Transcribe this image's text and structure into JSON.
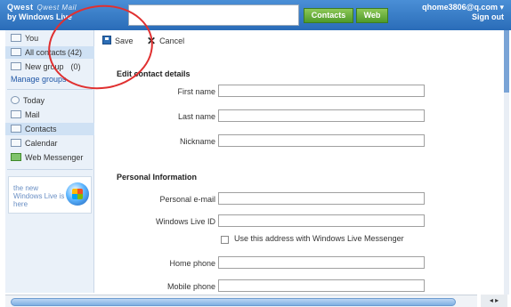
{
  "header": {
    "brand_line1": "Qwest",
    "brand_mail": "Qwest Mail",
    "brand_line2": "by Windows Live",
    "search_placeholder": "",
    "contacts_button": "Contacts",
    "web_button": "Web",
    "user_email": "qhome3806@q.com",
    "sign_out": "Sign out"
  },
  "sidebar": {
    "you": "You",
    "all_contacts": "All contacts",
    "all_contacts_count": "(42)",
    "new_group": "New group",
    "new_group_count": "(0)",
    "manage_groups": "Manage groups",
    "today": "Today",
    "mail": "Mail",
    "contacts": "Contacts",
    "calendar": "Calendar",
    "web_messenger": "Web Messenger",
    "promo_text": "the new Windows Live is here"
  },
  "toolbar": {
    "save": "Save",
    "cancel": "Cancel"
  },
  "form": {
    "section_contact": "Edit contact details",
    "first_name": "First name",
    "last_name": "Last name",
    "nickname": "Nickname",
    "section_personal": "Personal Information",
    "personal_email": "Personal e-mail",
    "windows_live_id": "Windows Live ID",
    "use_address_checkbox": "Use this address with Windows Live Messenger",
    "home_phone": "Home phone",
    "mobile_phone": "Mobile phone"
  },
  "colors": {
    "header": "#2a6cb8",
    "sidebar_bg": "#eaf1f9",
    "accent_green": "#4f9a2a",
    "annotation": "#e03030"
  }
}
